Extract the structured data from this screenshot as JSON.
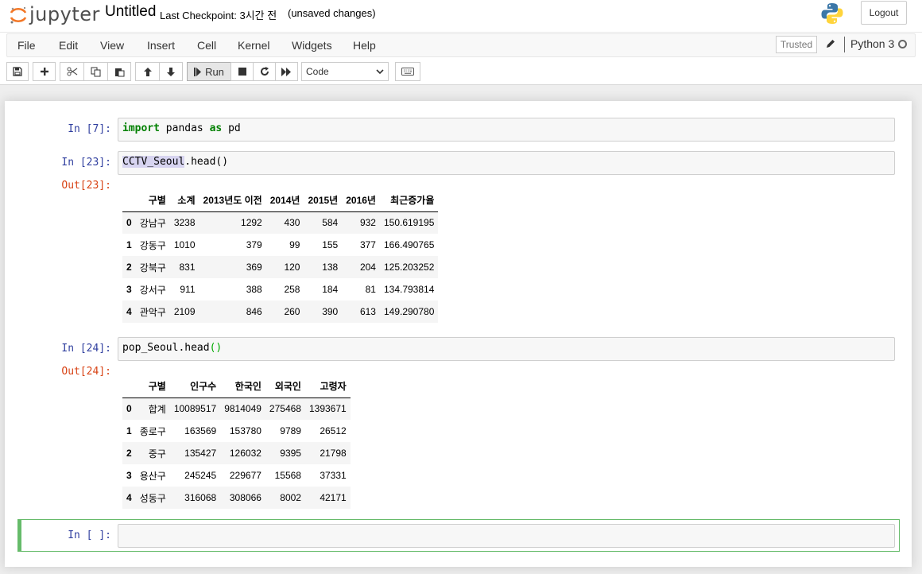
{
  "header": {
    "logo_text": "jupyter",
    "notebook_title": "Untitled",
    "checkpoint": "Last Checkpoint: 3시간 전",
    "autosave_status": "(unsaved changes)",
    "logout_label": "Logout"
  },
  "menubar": {
    "items": [
      "File",
      "Edit",
      "View",
      "Insert",
      "Cell",
      "Kernel",
      "Widgets",
      "Help"
    ],
    "trusted_label": "Trusted",
    "kernel_name": "Python 3"
  },
  "toolbar": {
    "run_label": "Run",
    "cell_type": "Code",
    "icons": [
      "save-icon",
      "plus-icon",
      "cut-icon",
      "copy-icon",
      "paste-icon",
      "arrow-up-icon",
      "arrow-down-icon",
      "run-icon",
      "stop-icon",
      "restart-icon",
      "fast-forward-icon",
      "keyboard-icon"
    ]
  },
  "cells": {
    "c1": {
      "prompt": "In [7]:",
      "code": [
        "import",
        " pandas ",
        "as",
        " pd"
      ]
    },
    "c2": {
      "prompt": "In [23]:",
      "out_prompt": "Out[23]:",
      "code_hl": "CCTV_Seoul",
      "code_rest": ".head()"
    },
    "c3": {
      "prompt": "In [24]:",
      "out_prompt": "Out[24]:",
      "code_main": "pop_Seoul.head",
      "code_paren": "()"
    },
    "c4": {
      "prompt": "In [ ]:"
    }
  },
  "table_cctv": {
    "columns": [
      "",
      "구별",
      "소계",
      "2013년도 이전",
      "2014년",
      "2015년",
      "2016년",
      "최근증가율"
    ],
    "rows": [
      [
        "0",
        "강남구",
        "3238",
        "1292",
        "430",
        "584",
        "932",
        "150.619195"
      ],
      [
        "1",
        "강동구",
        "1010",
        "379",
        "99",
        "155",
        "377",
        "166.490765"
      ],
      [
        "2",
        "강북구",
        "831",
        "369",
        "120",
        "138",
        "204",
        "125.203252"
      ],
      [
        "3",
        "강서구",
        "911",
        "388",
        "258",
        "184",
        "81",
        "134.793814"
      ],
      [
        "4",
        "관악구",
        "2109",
        "846",
        "260",
        "390",
        "613",
        "149.290780"
      ]
    ]
  },
  "table_pop": {
    "columns": [
      "",
      "구별",
      "인구수",
      "한국인",
      "외국인",
      "고령자"
    ],
    "rows": [
      [
        "0",
        "합계",
        "10089517",
        "9814049",
        "275468",
        "1393671"
      ],
      [
        "1",
        "종로구",
        "163569",
        "153780",
        "9789",
        "26512"
      ],
      [
        "2",
        "중구",
        "135427",
        "126032",
        "9395",
        "21798"
      ],
      [
        "3",
        "용산구",
        "245245",
        "229677",
        "15568",
        "37331"
      ],
      [
        "4",
        "성동구",
        "316068",
        "308066",
        "8002",
        "42171"
      ]
    ]
  },
  "colors": {
    "in_prompt": "#303f9f",
    "out_prompt": "#d84315",
    "keyword": "#008000",
    "edit_mode_border": "#66bb6a"
  }
}
